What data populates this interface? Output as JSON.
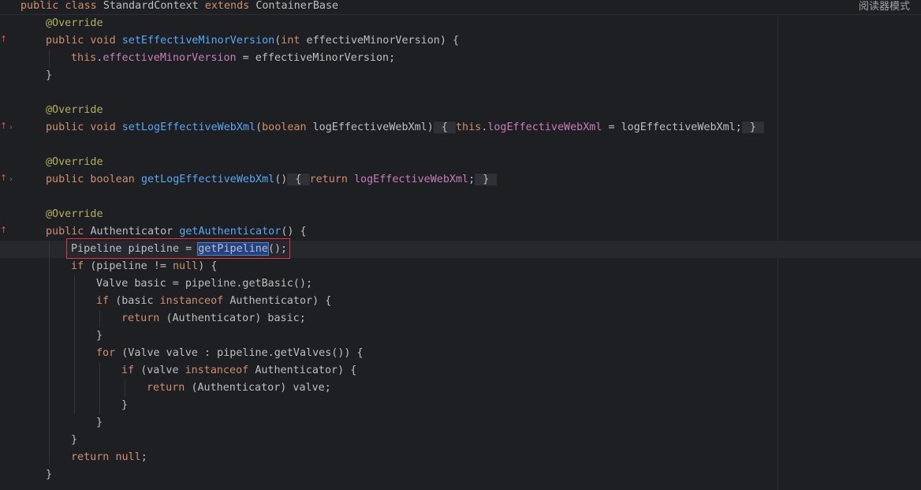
{
  "sticky_header": {
    "parts": [
      {
        "text": "public class ",
        "kind": "kw"
      },
      {
        "text": "StandardContext ",
        "kind": "plain"
      },
      {
        "text": "extends ",
        "kind": "kw"
      },
      {
        "text": "ContainerBase",
        "kind": "plain"
      }
    ]
  },
  "reader_mode_label": "阅读器模式",
  "gutter_icons": {
    "override": "override-arrow-icon",
    "fold": "chevron-right-icon"
  },
  "lines": [
    {
      "indent": 0,
      "parts": [
        {
          "text": "@Override",
          "kind": "ann"
        }
      ]
    },
    {
      "indent": 0,
      "gutter": "override",
      "parts": [
        {
          "text": "public void ",
          "kind": "kw"
        },
        {
          "text": "setEffectiveMinorVersion",
          "kind": "fn"
        },
        {
          "text": "(",
          "kind": "plain"
        },
        {
          "text": "int ",
          "kind": "kw"
        },
        {
          "text": "effectiveMinorVersion) {",
          "kind": "plain"
        }
      ]
    },
    {
      "indent": 1,
      "parts": [
        {
          "text": "this",
          "kind": "kw"
        },
        {
          "text": ".",
          "kind": "plain"
        },
        {
          "text": "effectiveMinorVersion",
          "kind": "field"
        },
        {
          "text": " = effectiveMinorVersion;",
          "kind": "plain"
        }
      ]
    },
    {
      "indent": 0,
      "parts": [
        {
          "text": "}",
          "kind": "plain"
        }
      ]
    },
    {
      "indent": 0,
      "parts": []
    },
    {
      "indent": 0,
      "parts": [
        {
          "text": "@Override",
          "kind": "ann"
        }
      ]
    },
    {
      "indent": 0,
      "gutter": "override",
      "fold": true,
      "parts": [
        {
          "text": "public void ",
          "kind": "kw"
        },
        {
          "text": "setLogEffectiveWebXml",
          "kind": "fn"
        },
        {
          "text": "(",
          "kind": "plain"
        },
        {
          "text": "boolean ",
          "kind": "kw"
        },
        {
          "text": "logEffectiveWebXml)",
          "kind": "plain"
        },
        {
          "text": " { ",
          "kind": "brace"
        },
        {
          "text": "this",
          "kind": "kw"
        },
        {
          "text": ".",
          "kind": "plain"
        },
        {
          "text": "logEffectiveWebXml",
          "kind": "field"
        },
        {
          "text": " = logEffectiveWebXml;",
          "kind": "plain"
        },
        {
          "text": " } ",
          "kind": "brace"
        }
      ]
    },
    {
      "indent": 0,
      "parts": []
    },
    {
      "indent": 0,
      "parts": [
        {
          "text": "@Override",
          "kind": "ann"
        }
      ]
    },
    {
      "indent": 0,
      "gutter": "override",
      "fold": true,
      "parts": [
        {
          "text": "public boolean ",
          "kind": "kw"
        },
        {
          "text": "getLogEffectiveWebXml",
          "kind": "fn"
        },
        {
          "text": "()",
          "kind": "plain"
        },
        {
          "text": " { ",
          "kind": "brace"
        },
        {
          "text": "return ",
          "kind": "kw"
        },
        {
          "text": "logEffectiveWebXml",
          "kind": "field"
        },
        {
          "text": ";",
          "kind": "plain"
        },
        {
          "text": " } ",
          "kind": "brace"
        }
      ]
    },
    {
      "indent": 0,
      "parts": []
    },
    {
      "indent": 0,
      "parts": [
        {
          "text": "@Override",
          "kind": "ann"
        }
      ]
    },
    {
      "indent": 0,
      "gutter": "override",
      "parts": [
        {
          "text": "public ",
          "kind": "kw"
        },
        {
          "text": "Authenticator ",
          "kind": "plain"
        },
        {
          "text": "getAuthenticator",
          "kind": "fn"
        },
        {
          "text": "() {",
          "kind": "plain"
        }
      ]
    },
    {
      "indent": 1,
      "current": true,
      "parts": [
        {
          "text": "Pipeline pipeline = ",
          "kind": "plain"
        },
        {
          "text": "getPipeline",
          "kind": "sel"
        },
        {
          "text": "();",
          "kind": "plain"
        }
      ]
    },
    {
      "indent": 1,
      "parts": [
        {
          "text": "if ",
          "kind": "kw"
        },
        {
          "text": "(pipeline != ",
          "kind": "plain"
        },
        {
          "text": "null",
          "kind": "kw"
        },
        {
          "text": ") {",
          "kind": "plain"
        }
      ]
    },
    {
      "indent": 2,
      "parts": [
        {
          "text": "Valve basic = pipeline.getBasic();",
          "kind": "plain"
        }
      ]
    },
    {
      "indent": 2,
      "parts": [
        {
          "text": "if ",
          "kind": "kw"
        },
        {
          "text": "(basic ",
          "kind": "plain"
        },
        {
          "text": "instanceof ",
          "kind": "kw"
        },
        {
          "text": "Authenticator) {",
          "kind": "plain"
        }
      ]
    },
    {
      "indent": 3,
      "parts": [
        {
          "text": "return ",
          "kind": "kw"
        },
        {
          "text": "(Authenticator) basic;",
          "kind": "plain"
        }
      ]
    },
    {
      "indent": 2,
      "parts": [
        {
          "text": "}",
          "kind": "plain"
        }
      ]
    },
    {
      "indent": 2,
      "parts": [
        {
          "text": "for ",
          "kind": "kw"
        },
        {
          "text": "(Valve valve : pipeline.getValves()) {",
          "kind": "plain"
        }
      ]
    },
    {
      "indent": 3,
      "parts": [
        {
          "text": "if ",
          "kind": "kw"
        },
        {
          "text": "(valve ",
          "kind": "plain"
        },
        {
          "text": "instanceof ",
          "kind": "kw"
        },
        {
          "text": "Authenticator) {",
          "kind": "plain"
        }
      ]
    },
    {
      "indent": 4,
      "parts": [
        {
          "text": "return ",
          "kind": "kw"
        },
        {
          "text": "(Authenticator) valve;",
          "kind": "plain"
        }
      ]
    },
    {
      "indent": 3,
      "parts": [
        {
          "text": "}",
          "kind": "plain"
        }
      ]
    },
    {
      "indent": 2,
      "parts": [
        {
          "text": "}",
          "kind": "plain"
        }
      ]
    },
    {
      "indent": 1,
      "parts": [
        {
          "text": "}",
          "kind": "plain"
        }
      ]
    },
    {
      "indent": 1,
      "parts": [
        {
          "text": "return ",
          "kind": "kw"
        },
        {
          "text": "null",
          "kind": "kw"
        },
        {
          "text": ";",
          "kind": "plain"
        }
      ]
    },
    {
      "indent": 0,
      "parts": [
        {
          "text": "}",
          "kind": "plain"
        }
      ]
    }
  ],
  "colors": {
    "background": "#1e1f22",
    "keyword": "#cf8e6d",
    "annotation": "#b3ae60",
    "method": "#56a8f5",
    "field": "#c77dbb",
    "text": "#bcbec4",
    "highlight_box": "#e0383e",
    "selection": "#214283"
  }
}
